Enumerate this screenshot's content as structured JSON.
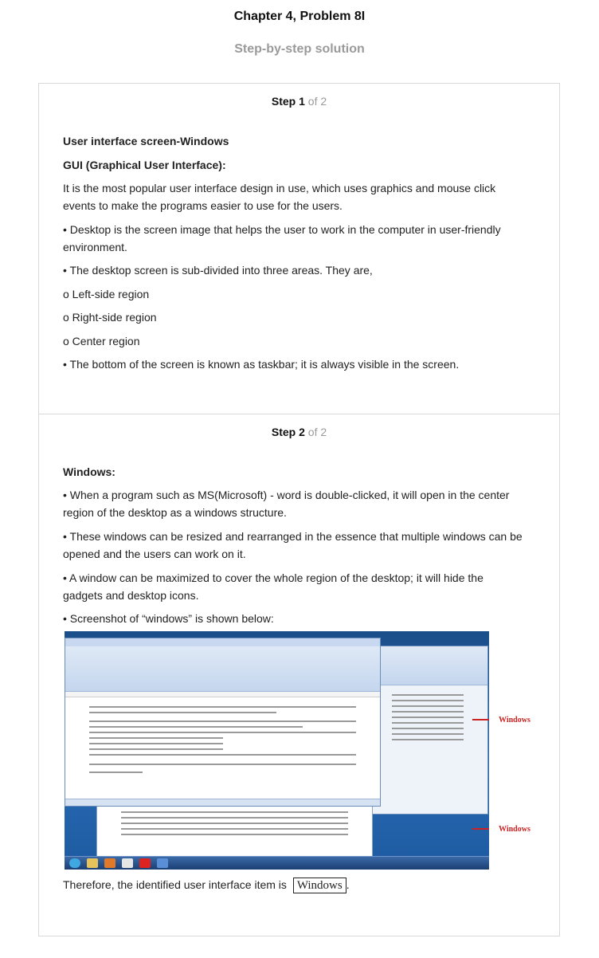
{
  "title": "Chapter 4, Problem 8I",
  "subtitle": "Step-by-step solution",
  "steps": [
    {
      "label": "Step",
      "number": "1",
      "of": "of 2",
      "heading": "User interface screen-Windows",
      "subheading": "GUI (Graphical User Interface):",
      "paragraphs": [
        "It is the most popular user interface design in use, which uses graphics and mouse click events to make the programs easier to use for the users.",
        "• Desktop is the screen image that helps the user to work in the computer in user-friendly environment.",
        "• The desktop screen is sub-divided into three areas. They are,",
        "o Left-side region",
        "o Right-side region",
        "o Center region",
        "• The bottom of the screen is known as taskbar; it is always visible in the screen."
      ]
    },
    {
      "label": "Step",
      "number": "2",
      "of": "of 2",
      "heading": "Windows:",
      "paragraphs": [
        "• When a program such as MS(Microsoft) - word is double-clicked, it will open in the center region of the desktop as a windows structure.",
        "• These windows can be resized and rearranged in the essence that multiple windows can be opened and the users can work on it.",
        "• A window can be maximized to cover the whole region of the desktop; it will hide the gadgets and desktop icons.",
        "• Screenshot of “windows” is shown below:"
      ],
      "figure": {
        "annotation_top": "Windows",
        "annotation_bottom": "Windows"
      },
      "conclusion": "Therefore, the identified user interface item is",
      "answer": "Windows",
      "answer_suffix": "."
    }
  ]
}
